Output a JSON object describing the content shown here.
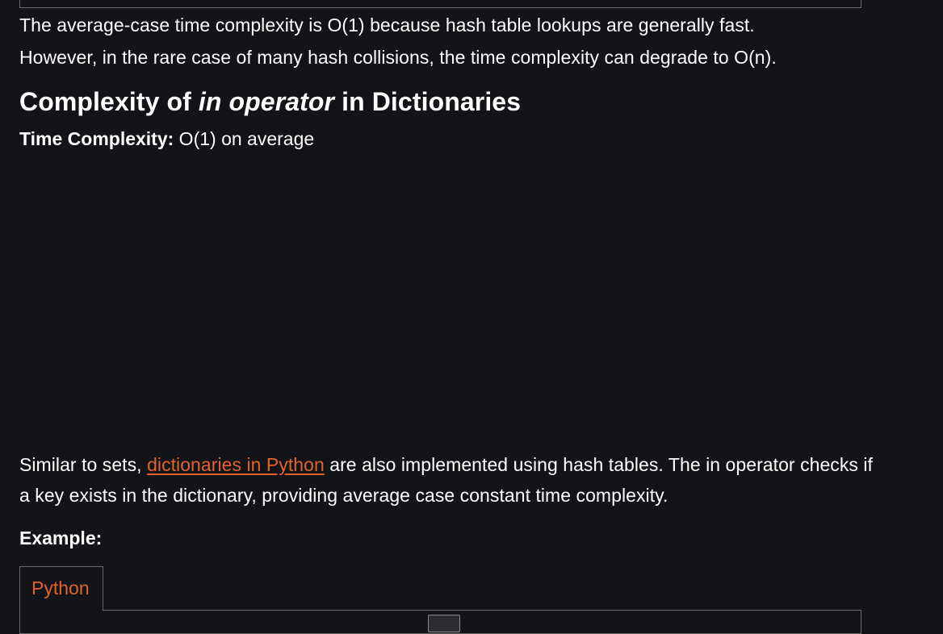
{
  "intro_paragraph": {
    "line1": "The average-case time complexity is O(1) because hash table lookups are generally fast.",
    "line2": "However, in the rare case of many hash collisions, the time complexity can degrade to O(n)."
  },
  "section": {
    "title_prefix": "Complexity of ",
    "title_emphasis": "in operator",
    "title_suffix": " in Dictionaries",
    "time_complexity_label": "Time Complexity:",
    "time_complexity_value": " O(1) on average"
  },
  "body_paragraph": {
    "before_link": "Similar to sets, ",
    "link_text": "dictionaries in Python",
    "after_link": " are also implemented using hash tables. The in operator checks if a key exists in the dictionary, providing average case constant time complexity."
  },
  "example_label": "Example:",
  "code_tabs": [
    {
      "label": "Python"
    }
  ],
  "colors": {
    "background": "#131417",
    "text": "#ffffff",
    "accent": "#e2622b",
    "border": "#6b6b6b"
  }
}
